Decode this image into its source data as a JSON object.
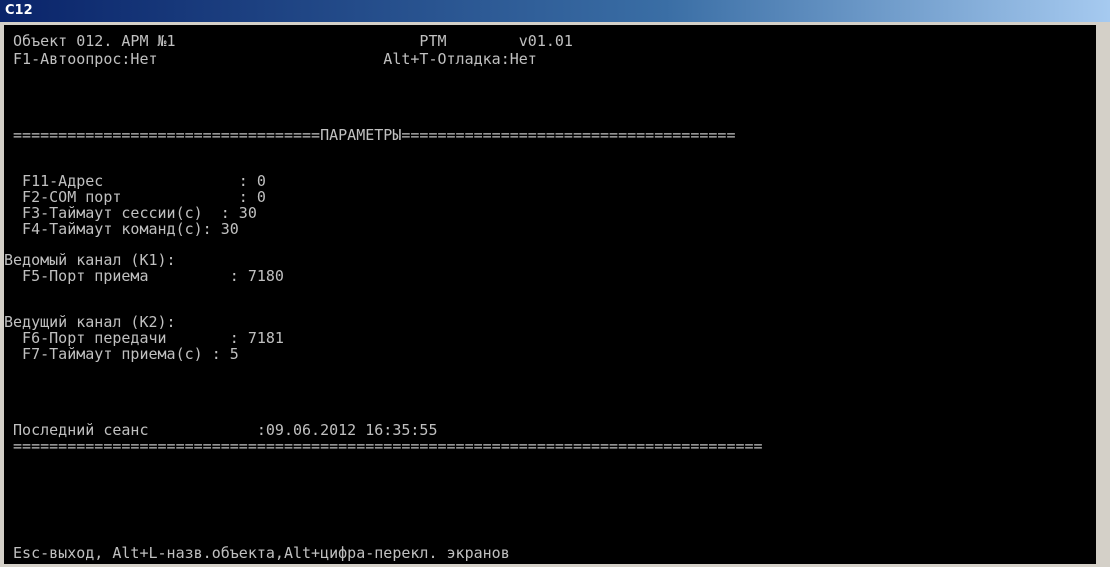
{
  "window": {
    "title": "C12"
  },
  "console": {
    "lines": {
      "header1": " Объект 012. АРМ №1                           РТМ        v01.01",
      "header2": " F1-Автоопрос:Нет                         Alt+T-Отладка:Нет",
      "section": " ==================================ПАРАМЕТРЫ=====================================",
      "p_address": "  F11-Адрес               : 0",
      "p_com": "  F2-COM порт             : 0",
      "p_session": "  F3-Таймаут сессии(с)  : 30",
      "p_command": "  F4-Таймаут команд(с): 30",
      "slave_head": "Ведомый канал (К1):",
      "p_recv_port": "  F5-Порт приема         : 7180",
      "master_head": "Ведущий канал (К2):",
      "p_send_port": "  F6-Порт передачи       : 7181",
      "p_recv_timeout": "  F7-Таймаут приема(с) : 5",
      "last_session": " Последний сеанс            :09.06.2012 16:35:55",
      "divider": " ===================================================================================",
      "footer": " Esc-выход, Alt+L-назв.объекта,Alt+цифра-перекл. экранов"
    }
  },
  "colors": {
    "console_bg": "#000000",
    "console_text": "#c0c0c0",
    "title_bar": "#0a246a",
    "title_text": "#ffffff"
  }
}
